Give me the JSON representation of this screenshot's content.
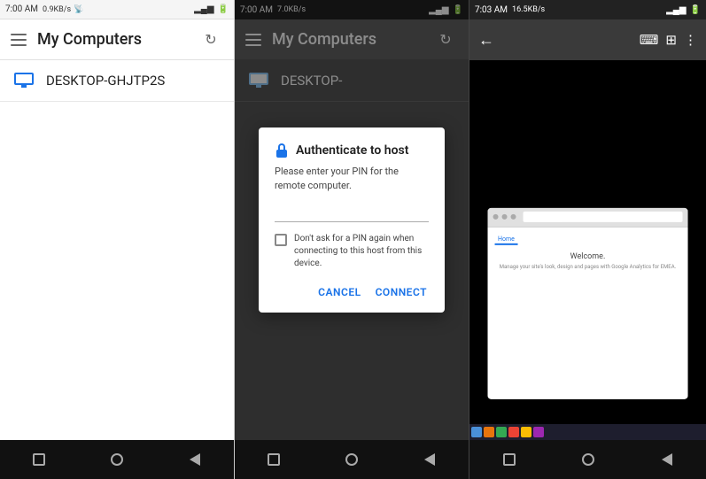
{
  "panel_left": {
    "status_bar": {
      "time": "7:00 AM",
      "network": "0.9KB/s",
      "battery": "🔋"
    },
    "app_bar": {
      "title": "My Computers",
      "menu_icon": "hamburger",
      "refresh_icon": "refresh"
    },
    "computers": [
      {
        "name": "DESKTOP-GHJTP2S"
      }
    ],
    "nav_buttons": [
      "square",
      "circle",
      "triangle"
    ]
  },
  "panel_mid": {
    "status_bar": {
      "time": "7:00 AM",
      "network": "7.0KB/s"
    },
    "app_bar": {
      "title": "My Computers",
      "menu_icon": "hamburger",
      "refresh_icon": "refresh"
    },
    "computers": [
      {
        "name": "DESKTOP-"
      }
    ],
    "dialog": {
      "title": "Authenticate to host",
      "subtitle": "Please enter your PIN for the remote computer.",
      "input_placeholder": "",
      "checkbox_label": "Don't ask for a PIN again when connecting to this host from this device.",
      "cancel_button": "CANCEL",
      "connect_button": "CONNECT"
    },
    "nav_buttons": [
      "square",
      "circle",
      "triangle"
    ]
  },
  "panel_right": {
    "status_bar": {
      "time": "7:03 AM",
      "network": "16.5KB/s"
    },
    "app_bar": {
      "back_icon": "back-arrow",
      "keyboard_icon": "keyboard",
      "grid_icon": "grid",
      "more_icon": "more-vertical"
    },
    "browser": {
      "nav_items": [
        "Home"
      ],
      "welcome_title": "Welcome.",
      "welcome_text": "Manage your site's look, design and pages with Google Analytics for EMEA."
    },
    "taskbar_icons": [
      "icon1",
      "icon2",
      "icon3",
      "icon4",
      "icon5",
      "icon6"
    ],
    "nav_buttons": [
      "square",
      "circle",
      "triangle"
    ]
  }
}
